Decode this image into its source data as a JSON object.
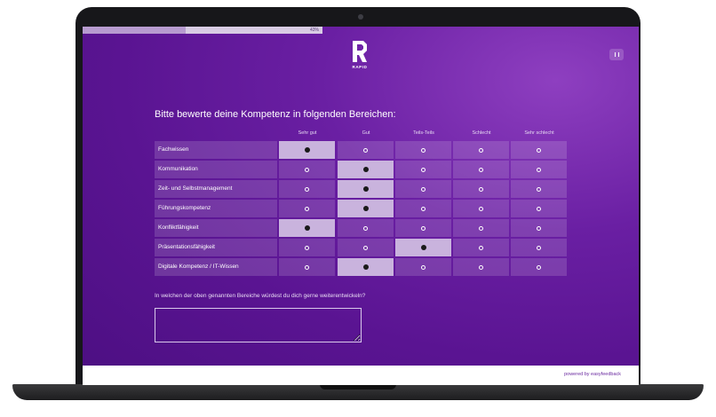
{
  "progress": {
    "label": "43%",
    "fraction": 0.43
  },
  "brand": {
    "logo_text": "RAPID"
  },
  "survey": {
    "question_title": "Bitte bewerte deine Kompetenz in folgenden Bereichen:",
    "columns": [
      "Sehr gut",
      "Gut",
      "Teils-Teils",
      "Schlecht",
      "Sehr schlecht"
    ],
    "rows": [
      {
        "label": "Fachwissen",
        "selected": 0
      },
      {
        "label": "Kommunikation",
        "selected": 1
      },
      {
        "label": "Zeit- und Selbstmanagement",
        "selected": 1
      },
      {
        "label": "Führungskompetenz",
        "selected": 1
      },
      {
        "label": "Konfliktfähigkeit",
        "selected": 0
      },
      {
        "label": "Präsentationsfähigkeit",
        "selected": 2
      },
      {
        "label": "Digitale Kompetenz / IT-Wissen",
        "selected": 1
      }
    ],
    "open_question": "In welchen der oben genannten Bereiche würdest du dich gerne weiterentwickeln?",
    "open_answer_value": ""
  },
  "footer": {
    "powered_by": "powered by easyfeedback"
  },
  "colors": {
    "background_accent": "#6a1fa3",
    "selected_cell": "#c9b3dd"
  },
  "icons": {
    "menu": "pause-icon",
    "logo": "rapid-logo-icon"
  }
}
